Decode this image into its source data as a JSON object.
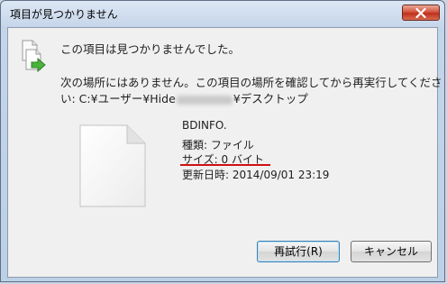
{
  "window": {
    "title": "項目が見つかりません"
  },
  "message": {
    "heading": "この項目は見つかりませんでした。",
    "line1": "次の場所にはありません。この項目の場所を確認してから再実行してくださ",
    "line2_prefix": "い: C:¥ユーザー¥Hide",
    "line2_suffix": "¥デスクトップ"
  },
  "file_info": {
    "name": "BDINFO.",
    "type": "種類: ファイル",
    "size": "サイズ: 0 バイト",
    "modified": "更新日時: 2014/09/01 23:19"
  },
  "buttons": {
    "retry": "再試行(R)",
    "cancel": "キャンセル"
  },
  "icons": {
    "close": "close-icon",
    "dialog": "file-move-icon",
    "file": "blank-document-icon"
  },
  "colors": {
    "annotation_underline": "#d01010"
  }
}
